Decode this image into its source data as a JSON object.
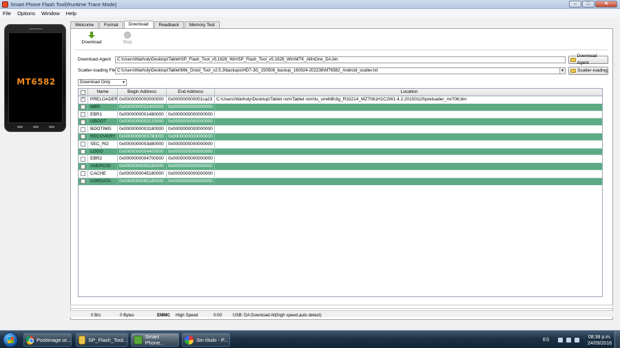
{
  "window": {
    "title": "Smart Phone Flash Tool(Runtime Trace Mode)",
    "buttons": {
      "minimize": "–",
      "maximize": "□",
      "close": "✕"
    }
  },
  "menu": [
    "File",
    "Options",
    "Window",
    "Help"
  ],
  "phone": {
    "model": "MT6582"
  },
  "tabs": [
    {
      "label": "Welcome",
      "active": false
    },
    {
      "label": "Format",
      "active": false
    },
    {
      "label": "Download",
      "active": true
    },
    {
      "label": "Readback",
      "active": false
    },
    {
      "label": "Memory Test",
      "active": false
    }
  ],
  "toolbar": {
    "download_label": "Download",
    "stop_label": "Stop"
  },
  "download_agent": {
    "label": "Download-Agent",
    "path": "C:\\Users\\Warholy\\Desktop\\Tablet\\SP_Flash_Tool_v5.1628_Win\\SP_Flash_Tool_v5.1628_Win\\MTK_AllInOne_DA.bin",
    "button": "Download Agent"
  },
  "scatter": {
    "label": "Scatter-loading File",
    "path": "C:\\Users\\Warholy\\Desktop\\Tablet\\Mtk_Droid_Tool_v2.5.3\\backups\\HD7-3G_150508_backup_160924-202238\\MT6582_Android_scatter.txt",
    "button": "Scatter-loading"
  },
  "mode": {
    "selected": "Download Only"
  },
  "table": {
    "headers": [
      "Name",
      "Begin Address",
      "End Address",
      "Location"
    ],
    "rows": [
      {
        "checked": true,
        "name": "PRELOADER",
        "begin": "0x0000000000000000",
        "end": "0x000000000001ca23",
        "location": "C:\\Users\\Warholy\\Desktop\\Tablet rom\\Tablet rom\\tu_sm4t8h3g_R32214_MZ7061H1C2W1.4.2.20150110\\preloader_mr706.bin",
        "highlight": false
      },
      {
        "checked": false,
        "name": "MBR",
        "begin": "0x0000000001400000",
        "end": "0x0000000000000000",
        "location": "",
        "highlight": true
      },
      {
        "checked": false,
        "name": "EBR1",
        "begin": "0x0000000001480000",
        "end": "0x0000000000000000",
        "location": "",
        "highlight": false
      },
      {
        "checked": false,
        "name": "UBOOT",
        "begin": "0x0000000003120000",
        "end": "0x0000000000000000",
        "location": "",
        "highlight": true
      },
      {
        "checked": false,
        "name": "BOOTIMG",
        "begin": "0x0000000003180000",
        "end": "0x0000000000000000",
        "location": "",
        "highlight": false
      },
      {
        "checked": false,
        "name": "RECOVERY",
        "begin": "0x0000000003780000",
        "end": "0x0000000000000000",
        "location": "",
        "highlight": true
      },
      {
        "checked": false,
        "name": "SEC_RO",
        "begin": "0x0000000003d80000",
        "end": "0x0000000000000000",
        "location": "",
        "highlight": false
      },
      {
        "checked": false,
        "name": "LOGO",
        "begin": "0x0000000004400000",
        "end": "0x0000000000000000",
        "location": "",
        "highlight": true
      },
      {
        "checked": false,
        "name": "EBR2",
        "begin": "0x0000000004700000",
        "end": "0x0000000000000000",
        "location": "",
        "highlight": false
      },
      {
        "checked": false,
        "name": "ANDROID",
        "begin": "0x0000000005180000",
        "end": "0x0000000000000000",
        "location": "",
        "highlight": true
      },
      {
        "checked": false,
        "name": "CACHE",
        "begin": "0x0000000045180000",
        "end": "0x0000000000000000",
        "location": "",
        "highlight": false
      },
      {
        "checked": false,
        "name": "USRDATA",
        "begin": "0x0000000065180000",
        "end": "0x0000000000000000",
        "location": "",
        "highlight": true
      }
    ]
  },
  "status": {
    "speed": "0 B/s",
    "bytes": "0 Bytes",
    "storage": "EMMC",
    "usb_speed": "High Speed",
    "time": "0:00",
    "message": "USB: DA Download All(high speed,auto detect)"
  },
  "taskbar": {
    "items": [
      {
        "label": "Postimage.or...",
        "icon": "chrome-icon",
        "active": false
      },
      {
        "label": "SP_Flash_Tool...",
        "icon": "folder-icon",
        "active": false
      },
      {
        "label": "Smart Phone...",
        "icon": "sp-flash-tool-icon",
        "active": true
      },
      {
        "label": "Sin título - P...",
        "icon": "paint-icon",
        "active": false
      }
    ],
    "language": "ES",
    "time": "08:38 p.m.",
    "date": "24/09/2016"
  },
  "colors": {
    "highlight_row": "#5cab84",
    "phone_model": "#f08a1c"
  }
}
